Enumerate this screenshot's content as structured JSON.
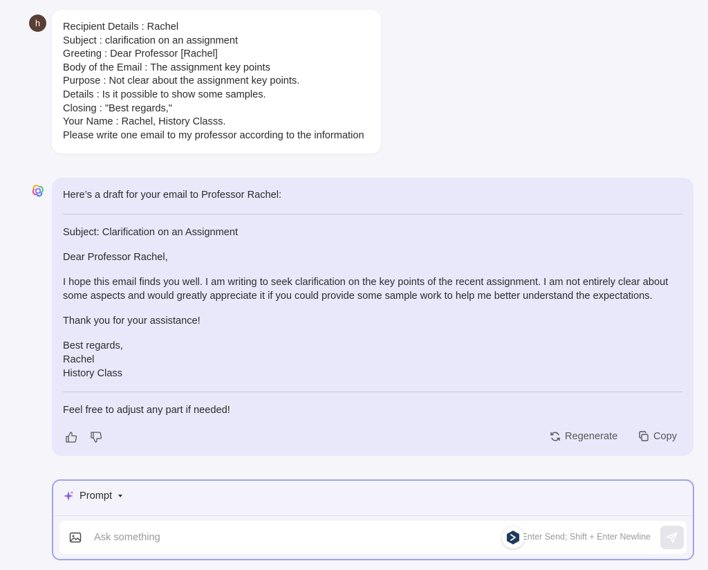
{
  "user": {
    "avatar_letter": "h",
    "lines": [
      "Recipient Details : Rachel",
      "Subject : clarification on an assignment",
      "Greeting : Dear Professor [Rachel]",
      "Body of the Email : The assignment key points",
      "Purpose : Not clear about the assignment key points.",
      "Details : Is it possible to show some samples.",
      "Closing : \"Best regards,\"",
      "Your Name : Rachel, History Classs.",
      "Please write one email to my professor according to the information"
    ]
  },
  "assistant": {
    "intro": "Here’s a draft for your email to Professor Rachel:",
    "subject": "Subject: Clarification on an Assignment",
    "salutation": "Dear Professor Rachel,",
    "body": "I hope this email finds you well. I am writing to seek clarification on the key points of the recent assignment. I am not entirely clear about some aspects and would greatly appreciate it if you could provide some sample work to help me better understand the expectations.",
    "thanks": "Thank you for your assistance!",
    "closing_1": "Best regards,",
    "closing_2": "Rachel",
    "closing_3": "History Class",
    "footer": "Feel free to adjust any part if needed!",
    "regenerate_label": "Regenerate",
    "copy_label": "Copy"
  },
  "composer": {
    "mode_label": "Prompt",
    "placeholder": "Ask something",
    "hint": "Enter Send; Shift + Enter Newline"
  },
  "icons": {
    "bot": "colorful-logo-icon",
    "thumbs_up": "thumbs-up-icon",
    "thumbs_down": "thumbs-down-icon",
    "regenerate": "refresh-icon",
    "copy": "copy-icon",
    "sparkle": "sparkle-icon",
    "dropdown": "caret-down-icon",
    "image": "image-icon",
    "send": "send-icon"
  },
  "colors": {
    "page_bg": "#f5f5fa",
    "assistant_bubble": "#e9e8fb",
    "user_bubble": "#ffffff",
    "composer_border": "#9fa3e8",
    "avatar": "#5a3e36"
  }
}
